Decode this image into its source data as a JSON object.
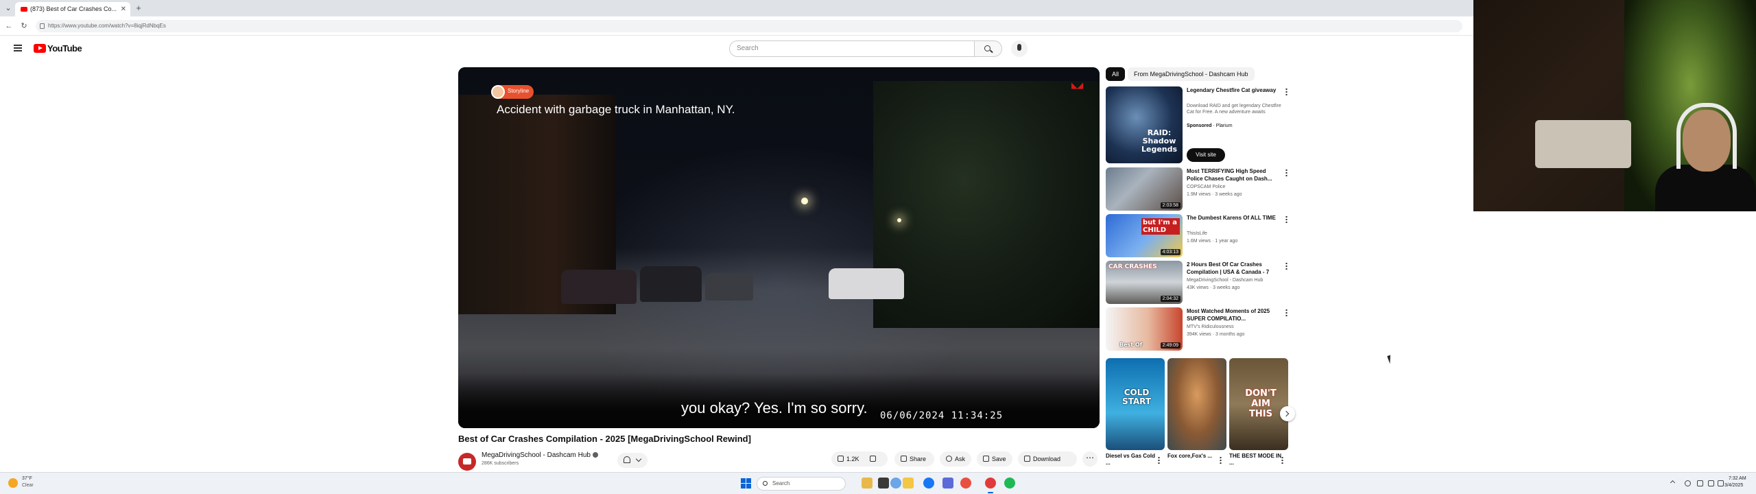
{
  "browser": {
    "tab_title": "(873) Best of Car Crashes Co...",
    "url": "https://www.youtube.com/watch?v=8iqjRdNbqEs"
  },
  "header": {
    "logo_text": "YouTube",
    "search_placeholder": "Search"
  },
  "player": {
    "channel_chip": "Storyline",
    "overlay_title": "Accident with garbage truck in Manhattan, NY.",
    "subtitle": "you okay? Yes. I'm so sorry.",
    "timestamp": "06/06/2024  11:34:25"
  },
  "video": {
    "title": "Best of Car Crashes Compilation - 2025 [MegaDrivingSchool Rewind]",
    "channel": "MegaDrivingSchool - Dashcam Hub",
    "subscribers": "286K subscribers",
    "likes": "1.2K",
    "actions": {
      "share": "Share",
      "ask": "Ask",
      "save": "Save",
      "download": "Download"
    }
  },
  "sidebar": {
    "chips": [
      "All",
      "From MegaDrivingSchool - Dashcam Hub"
    ],
    "ad": {
      "title": "Legendary Chestfire Cat giveaway",
      "description": "Download RAID and get legendary Chestfire Cat for Free. A new adventure awaits",
      "sponsored": "Sponsored",
      "advertiser": "Plarium",
      "cta": "Visit site",
      "thumb_text": "RAID: Shadow Legends"
    },
    "recommendations": [
      {
        "title": "Most TERRIFYING High Speed Police Chases Caught on Dash...",
        "channel": "COPSCAM Police",
        "meta": "1.9M views · 3 weeks ago",
        "duration": "2:03:58"
      },
      {
        "title": "The Dumbest Karens Of ALL TIME",
        "channel": "ThisIsLife",
        "meta": "1.6M views · 1 year ago",
        "duration": "4:03:13",
        "thumb_text": "but I'm a CHILD"
      },
      {
        "title": "2 Hours Best Of Car Crashes Compilation | USA & Canada - 7",
        "channel": "MegaDrivingSchool - Dashcam Hub",
        "meta": "43K views · 3 weeks ago",
        "duration": "2:04:32",
        "thumb_text": "CAR CRASHES"
      },
      {
        "title": "Most Watched Moments of 2025 SUPER COMPILATIO...",
        "channel": "MTV's Ridiculousness",
        "meta": "394K views · 3 months ago",
        "duration": "2:49:09",
        "thumb_text": "Best Of"
      }
    ],
    "shorts": [
      {
        "title": "Diesel vs Gas Cold ...",
        "thumb_text": "COLD START"
      },
      {
        "title": "Fox core,Fox's ...",
        "thumb_text": ""
      },
      {
        "title": "THE BEST MODE IN ...",
        "thumb_text": "DON'T AIM THIS"
      }
    ]
  },
  "taskbar": {
    "weather_temp": "37°F",
    "weather_cond": "Clear",
    "search_placeholder": "Search",
    "time": "7:32 AM",
    "date": "3/4/2025"
  }
}
